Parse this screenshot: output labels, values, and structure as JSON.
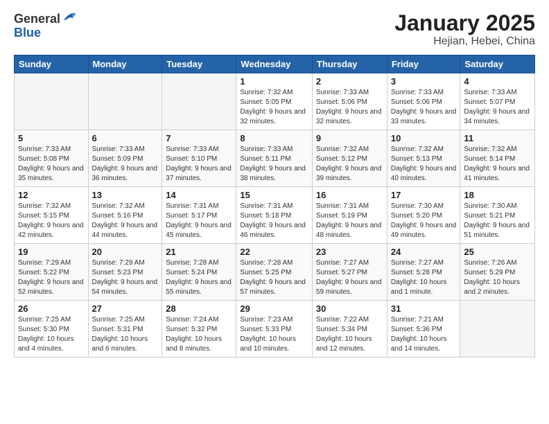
{
  "header": {
    "logo_general": "General",
    "logo_blue": "Blue",
    "month": "January 2025",
    "location": "Hejian, Hebei, China"
  },
  "weekdays": [
    "Sunday",
    "Monday",
    "Tuesday",
    "Wednesday",
    "Thursday",
    "Friday",
    "Saturday"
  ],
  "weeks": [
    [
      {
        "day": "",
        "info": ""
      },
      {
        "day": "",
        "info": ""
      },
      {
        "day": "",
        "info": ""
      },
      {
        "day": "1",
        "info": "Sunrise: 7:32 AM\nSunset: 5:05 PM\nDaylight: 9 hours and 32 minutes."
      },
      {
        "day": "2",
        "info": "Sunrise: 7:33 AM\nSunset: 5:06 PM\nDaylight: 9 hours and 32 minutes."
      },
      {
        "day": "3",
        "info": "Sunrise: 7:33 AM\nSunset: 5:06 PM\nDaylight: 9 hours and 33 minutes."
      },
      {
        "day": "4",
        "info": "Sunrise: 7:33 AM\nSunset: 5:07 PM\nDaylight: 9 hours and 34 minutes."
      }
    ],
    [
      {
        "day": "5",
        "info": "Sunrise: 7:33 AM\nSunset: 5:08 PM\nDaylight: 9 hours and 35 minutes."
      },
      {
        "day": "6",
        "info": "Sunrise: 7:33 AM\nSunset: 5:09 PM\nDaylight: 9 hours and 36 minutes."
      },
      {
        "day": "7",
        "info": "Sunrise: 7:33 AM\nSunset: 5:10 PM\nDaylight: 9 hours and 37 minutes."
      },
      {
        "day": "8",
        "info": "Sunrise: 7:33 AM\nSunset: 5:11 PM\nDaylight: 9 hours and 38 minutes."
      },
      {
        "day": "9",
        "info": "Sunrise: 7:32 AM\nSunset: 5:12 PM\nDaylight: 9 hours and 39 minutes."
      },
      {
        "day": "10",
        "info": "Sunrise: 7:32 AM\nSunset: 5:13 PM\nDaylight: 9 hours and 40 minutes."
      },
      {
        "day": "11",
        "info": "Sunrise: 7:32 AM\nSunset: 5:14 PM\nDaylight: 9 hours and 41 minutes."
      }
    ],
    [
      {
        "day": "12",
        "info": "Sunrise: 7:32 AM\nSunset: 5:15 PM\nDaylight: 9 hours and 42 minutes."
      },
      {
        "day": "13",
        "info": "Sunrise: 7:32 AM\nSunset: 5:16 PM\nDaylight: 9 hours and 44 minutes."
      },
      {
        "day": "14",
        "info": "Sunrise: 7:31 AM\nSunset: 5:17 PM\nDaylight: 9 hours and 45 minutes."
      },
      {
        "day": "15",
        "info": "Sunrise: 7:31 AM\nSunset: 5:18 PM\nDaylight: 9 hours and 46 minutes."
      },
      {
        "day": "16",
        "info": "Sunrise: 7:31 AM\nSunset: 5:19 PM\nDaylight: 9 hours and 48 minutes."
      },
      {
        "day": "17",
        "info": "Sunrise: 7:30 AM\nSunset: 5:20 PM\nDaylight: 9 hours and 49 minutes."
      },
      {
        "day": "18",
        "info": "Sunrise: 7:30 AM\nSunset: 5:21 PM\nDaylight: 9 hours and 51 minutes."
      }
    ],
    [
      {
        "day": "19",
        "info": "Sunrise: 7:29 AM\nSunset: 5:22 PM\nDaylight: 9 hours and 52 minutes."
      },
      {
        "day": "20",
        "info": "Sunrise: 7:29 AM\nSunset: 5:23 PM\nDaylight: 9 hours and 54 minutes."
      },
      {
        "day": "21",
        "info": "Sunrise: 7:28 AM\nSunset: 5:24 PM\nDaylight: 9 hours and 55 minutes."
      },
      {
        "day": "22",
        "info": "Sunrise: 7:28 AM\nSunset: 5:25 PM\nDaylight: 9 hours and 57 minutes."
      },
      {
        "day": "23",
        "info": "Sunrise: 7:27 AM\nSunset: 5:27 PM\nDaylight: 9 hours and 59 minutes."
      },
      {
        "day": "24",
        "info": "Sunrise: 7:27 AM\nSunset: 5:28 PM\nDaylight: 10 hours and 1 minute."
      },
      {
        "day": "25",
        "info": "Sunrise: 7:26 AM\nSunset: 5:29 PM\nDaylight: 10 hours and 2 minutes."
      }
    ],
    [
      {
        "day": "26",
        "info": "Sunrise: 7:25 AM\nSunset: 5:30 PM\nDaylight: 10 hours and 4 minutes."
      },
      {
        "day": "27",
        "info": "Sunrise: 7:25 AM\nSunset: 5:31 PM\nDaylight: 10 hours and 6 minutes."
      },
      {
        "day": "28",
        "info": "Sunrise: 7:24 AM\nSunset: 5:32 PM\nDaylight: 10 hours and 8 minutes."
      },
      {
        "day": "29",
        "info": "Sunrise: 7:23 AM\nSunset: 5:33 PM\nDaylight: 10 hours and 10 minutes."
      },
      {
        "day": "30",
        "info": "Sunrise: 7:22 AM\nSunset: 5:34 PM\nDaylight: 10 hours and 12 minutes."
      },
      {
        "day": "31",
        "info": "Sunrise: 7:21 AM\nSunset: 5:36 PM\nDaylight: 10 hours and 14 minutes."
      },
      {
        "day": "",
        "info": ""
      }
    ]
  ]
}
